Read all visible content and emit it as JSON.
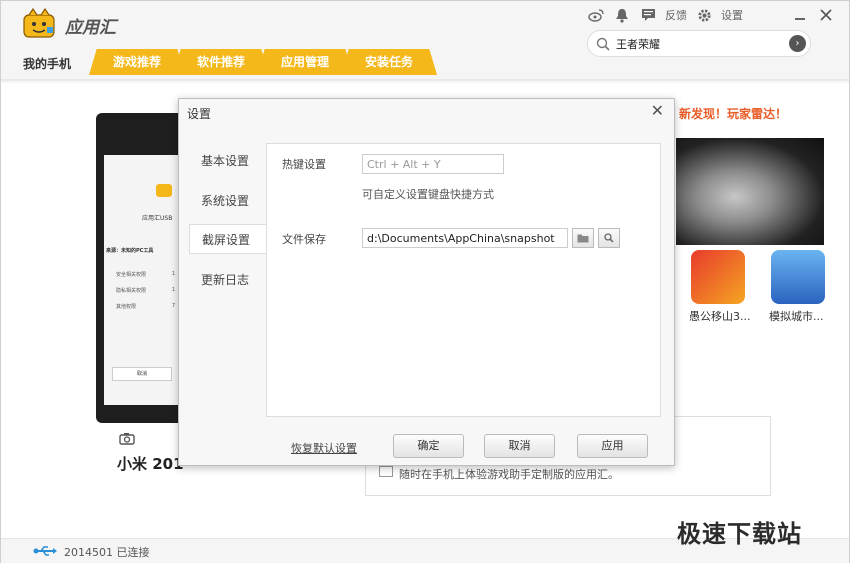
{
  "app": {
    "title": "应用汇",
    "my_phone": "我的手机",
    "tabs": [
      "游戏推荐",
      "软件推荐",
      "应用管理",
      "安装任务"
    ],
    "header_links": {
      "feedback": "反馈",
      "settings": "设置"
    },
    "search": {
      "value": "王者荣耀"
    }
  },
  "main": {
    "phone_label": "小米 201",
    "phone_screen": {
      "app_name": "应用汇USB",
      "source": "来源：未知的PC工具",
      "rows": [
        "安全相关权限",
        "隐私相关权限",
        "其他权限"
      ],
      "row_counts": [
        "1",
        "1",
        "7"
      ],
      "cancel": "取消"
    },
    "discover": "新发现！玩家雷达！",
    "apps": [
      "愚公移山3...",
      "模拟城市..."
    ],
    "tip": "随时在手机上体验游戏助手定制版的应用汇。"
  },
  "footer": {
    "status": "2014501 已连接",
    "watermark": "极速下载站"
  },
  "dialog": {
    "title": "设置",
    "nav": [
      "基本设置",
      "系统设置",
      "截屏设置",
      "更新日志"
    ],
    "hotkey_label": "热键设置",
    "hotkey_value": "Ctrl + Alt + Y",
    "hotkey_hint": "可自定义设置键盘快捷方式",
    "save_label": "文件保存",
    "save_path": "d:\\Documents\\AppChina\\snapshot",
    "restore_default": "恢复默认设置",
    "ok": "确定",
    "cancel": "取消",
    "apply": "应用"
  },
  "colors": {
    "tab_bg": "#f4b81a",
    "discover": "#e95d2a"
  }
}
